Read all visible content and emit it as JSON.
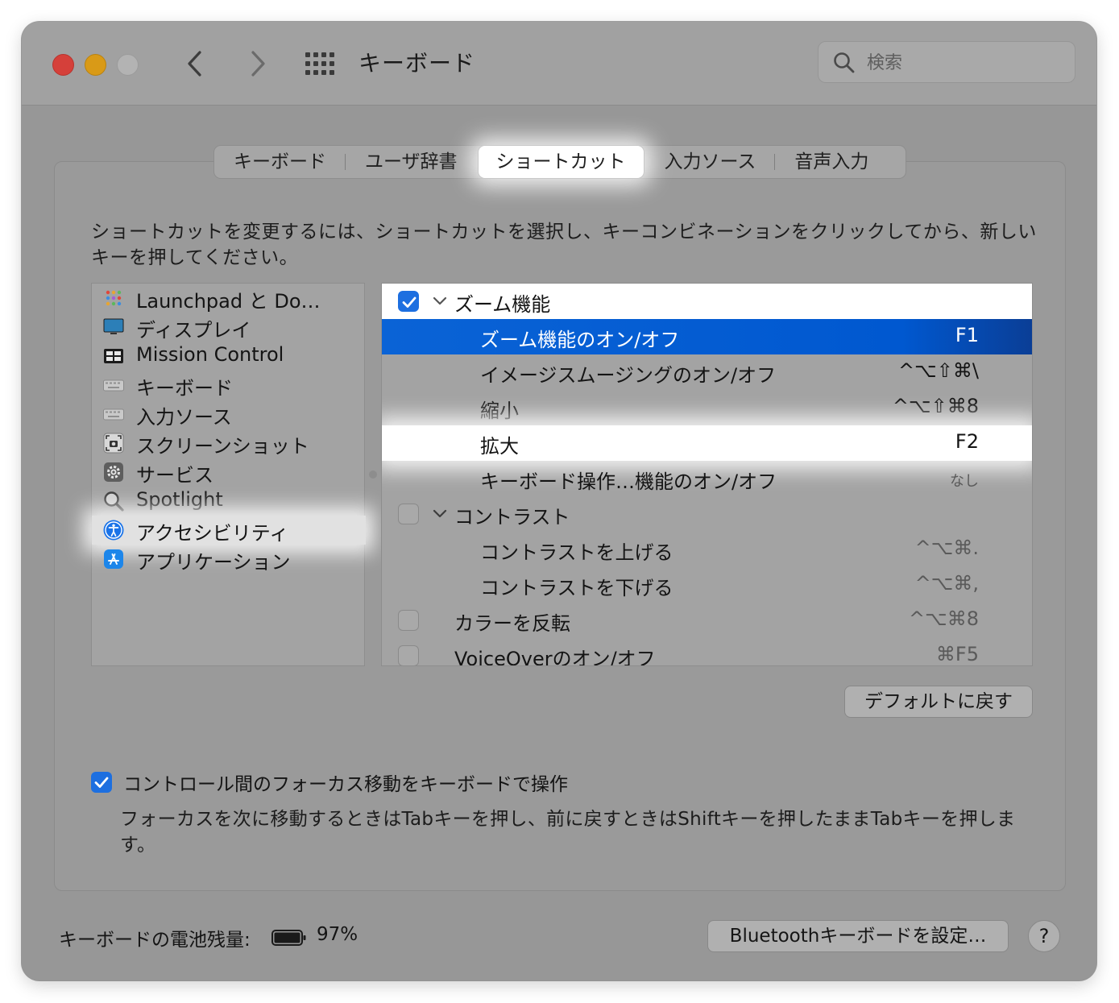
{
  "window": {
    "title": "キーボード"
  },
  "search": {
    "placeholder": "検索"
  },
  "tabs": [
    "キーボード",
    "ユーザ辞書",
    "ショートカット",
    "入力ソース",
    "音声入力"
  ],
  "description": "ショートカットを変更するには、ショートカットを選択し、キーコンビネーションをクリックしてから、新しいキーを押してください。",
  "categories": [
    {
      "label": "Launchpad と Do…",
      "icon": "launchpad-icon"
    },
    {
      "label": "ディスプレイ",
      "icon": "display-icon"
    },
    {
      "label": "Mission Control",
      "icon": "mission-control-icon"
    },
    {
      "label": "キーボード",
      "icon": "keyboard-icon"
    },
    {
      "label": "入力ソース",
      "icon": "input-source-icon"
    },
    {
      "label": "スクリーンショット",
      "icon": "screenshot-icon"
    },
    {
      "label": "サービス",
      "icon": "services-gear-icon"
    },
    {
      "label": "Spotlight",
      "icon": "spotlight-magnifier-icon"
    },
    {
      "label": "アクセシビリティ",
      "icon": "accessibility-icon"
    },
    {
      "label": "アプリケーション",
      "icon": "app-store-icon"
    }
  ],
  "shortcuts": [
    {
      "label": "ズーム機能",
      "key": "",
      "checked": true,
      "group": true
    },
    {
      "label": "ズーム機能のオン/オフ",
      "key": "F1"
    },
    {
      "label": "イメージスムージングのオン/オフ",
      "key": "^⌥⇧⌘\\"
    },
    {
      "label": "縮小",
      "key": "^⌥⇧⌘8"
    },
    {
      "label": "拡大",
      "key": "F2"
    },
    {
      "label": "キーボード操作…機能のオン/オフ",
      "key": "なし"
    },
    {
      "label": "コントラスト",
      "key": "",
      "checked": false,
      "group": true
    },
    {
      "label": "コントラストを上げる",
      "key": "^⌥⌘."
    },
    {
      "label": "コントラストを下げる",
      "key": "^⌥⌘,"
    },
    {
      "label": "カラーを反転",
      "key": "^⌥⌘8",
      "checked": false
    },
    {
      "label": "VoiceOverのオン/オフ",
      "key": "⌘F5",
      "checked": false
    }
  ],
  "buttons": {
    "restore_defaults": "デフォルトに戻す",
    "bluetooth_setup": "Bluetoothキーボードを設定…",
    "help": "?"
  },
  "focus": {
    "label": "コントロール間のフォーカス移動をキーボードで操作",
    "checked": true,
    "note": "フォーカスを次に移動するときはTabキーを押し、前に戻すときはShiftキーを押したままTabキーを押します。"
  },
  "battery": {
    "label": "キーボードの電池残量:",
    "percent": "97%",
    "level": 0.97
  },
  "colors": {
    "accent": "#1d6fe0",
    "selection": "#0058d0"
  }
}
